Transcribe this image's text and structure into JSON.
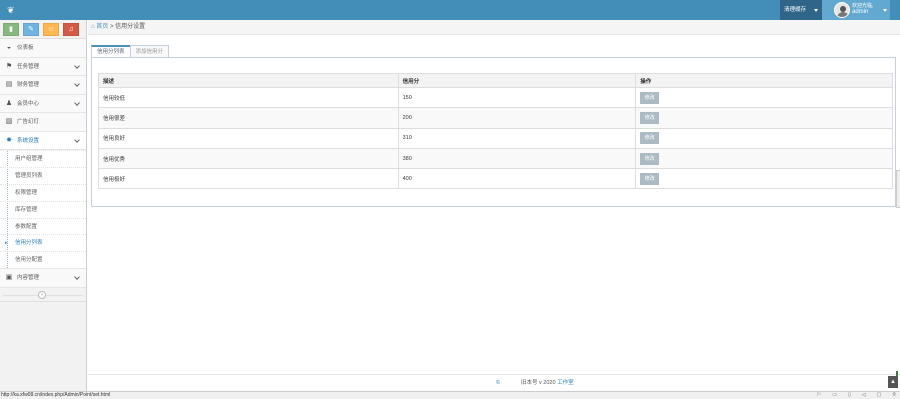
{
  "header": {
    "clear_cache": "清理缓存",
    "welcome": "欢迎光临,",
    "username": "admin"
  },
  "shortcuts": [
    {
      "icon": "chart-icon",
      "color": "#87b87f",
      "glyph": "▮"
    },
    {
      "icon": "pencil-icon",
      "color": "#6fb3e0",
      "glyph": "✎"
    },
    {
      "icon": "users-icon",
      "color": "#ffb752",
      "glyph": "☺"
    },
    {
      "icon": "bell-icon",
      "color": "#d15b47",
      "glyph": "♫"
    }
  ],
  "sidebar": {
    "items": [
      {
        "label": "仪表板",
        "icon": "dashboard-icon",
        "glyph": "◒"
      },
      {
        "label": "任务管理",
        "icon": "flag-icon",
        "glyph": "⚑"
      },
      {
        "label": "财务管理",
        "icon": "finance-icon",
        "glyph": "▤"
      },
      {
        "label": "会员中心",
        "icon": "user-icon",
        "glyph": "♟"
      },
      {
        "label": "广告幻灯",
        "icon": "picture-icon",
        "glyph": "▨"
      },
      {
        "label": "系统设置",
        "icon": "cog-icon",
        "glyph": "✸"
      }
    ],
    "submenu": [
      "用户组管理",
      "管理员列表",
      "权限管理",
      "库存管理",
      "参数配置",
      "信用分列表",
      "信用分配置"
    ],
    "content_item": {
      "label": "内容管理",
      "icon": "book-icon",
      "glyph": "▣"
    }
  },
  "breadcrumb": {
    "home": "首页",
    "separator": ">",
    "current": "信用分设置"
  },
  "tabs": [
    "信用分列表",
    "添加信用分"
  ],
  "table": {
    "headers": [
      "描述",
      "信用分",
      "操作"
    ],
    "rows": [
      {
        "desc": "信用较低",
        "score": "150",
        "action": "修改"
      },
      {
        "desc": "信用很差",
        "score": "200",
        "action": "修改"
      },
      {
        "desc": "信用良好",
        "score": "310",
        "action": "修改"
      },
      {
        "desc": "信用优秀",
        "score": "380",
        "action": "修改"
      },
      {
        "desc": "信用极好",
        "score": "400",
        "action": "修改"
      }
    ]
  },
  "footer": {
    "symbol": "©",
    "text": "旧本号 v 2020 ",
    "studio": "工作室"
  },
  "status_bar": {
    "url": "http://ka.xfw08.cn/index.php/Admin/Point/set.html"
  },
  "colors": {
    "topbar": "#438eb9",
    "accent": "#2b7dbc",
    "button": "#abbac3"
  }
}
